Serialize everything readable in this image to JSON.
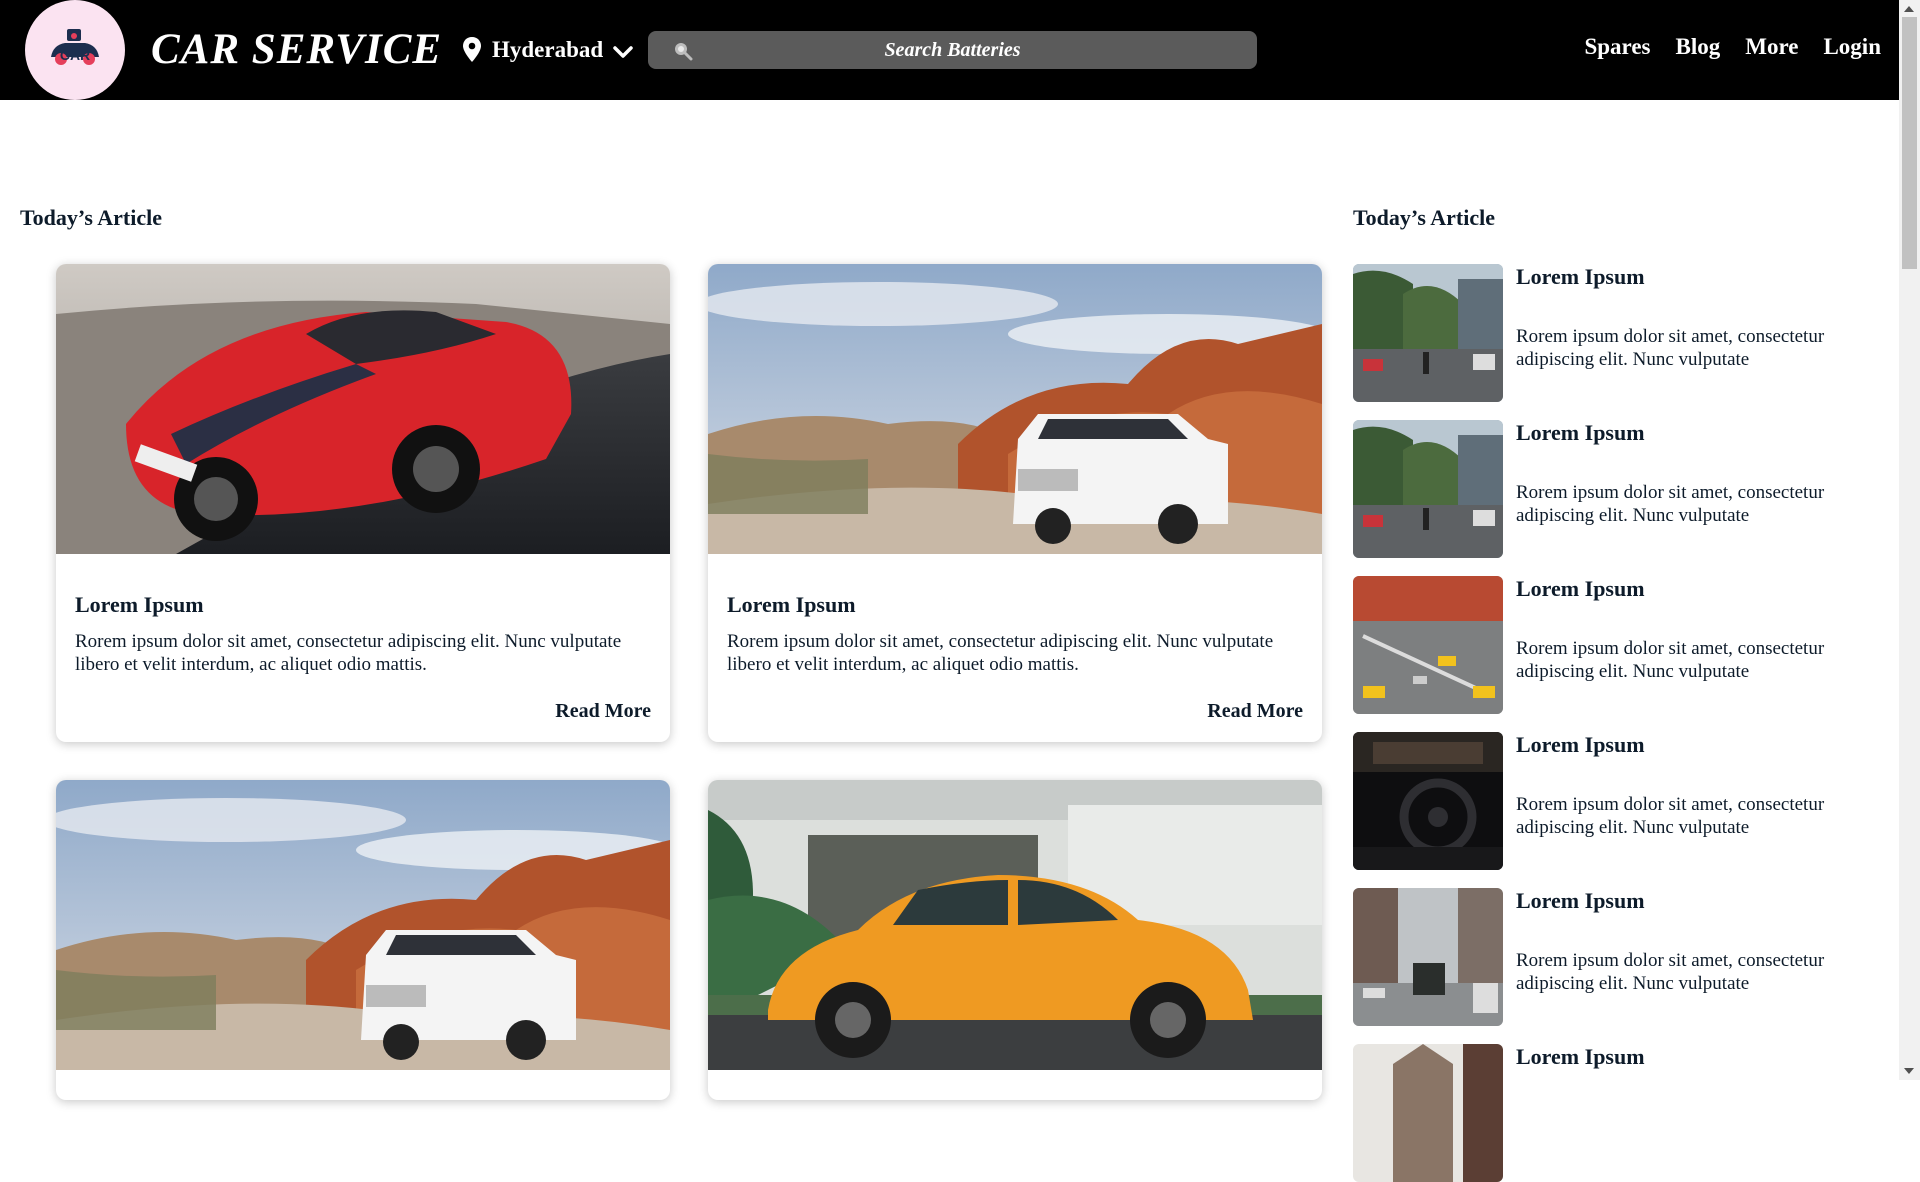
{
  "header": {
    "brand": "CAR SERVICE",
    "logo_icon": "car-logo-icon",
    "location": "Hyderabad",
    "search_placeholder": "Search Batteries",
    "nav": [
      "Spares",
      "Blog",
      "More",
      "Login"
    ]
  },
  "colors": {
    "header_bg": "#000000",
    "search_bg": "#5b5b5b",
    "logo_bg": "#fbe3f1",
    "text_dark": "#0d1b2a"
  },
  "main": {
    "section_title": "Today’s Article",
    "cards": [
      {
        "image": "red-sports-car-photo",
        "title": "Lorem Ipsum",
        "text": "Rorem ipsum dolor sit amet, consectetur adipiscing elit. Nunc vulputate libero et velit interdum, ac aliquet odio mattis.",
        "link": "Read More"
      },
      {
        "image": "white-suv-desert-photo",
        "title": "Lorem Ipsum",
        "text": "Rorem ipsum dolor sit amet, consectetur adipiscing elit. Nunc vulputate libero et velit interdum, ac aliquet odio mattis.",
        "link": "Read More"
      },
      {
        "image": "white-suv-desert-photo"
      },
      {
        "image": "orange-beetle-photo"
      }
    ]
  },
  "sidebar": {
    "section_title": "Today’s Article",
    "items": [
      {
        "image": "city-street-photo",
        "title": "Lorem Ipsum",
        "text": "Rorem ipsum dolor sit amet, consectetur adipiscing elit. Nunc vulputate"
      },
      {
        "image": "city-street-photo",
        "title": "Lorem Ipsum",
        "text": "Rorem ipsum dolor sit amet, consectetur adipiscing elit. Nunc vulputate"
      },
      {
        "image": "taxi-intersection-photo",
        "title": "Lorem Ipsum",
        "text": "Rorem ipsum dolor sit amet, consectetur adipiscing elit. Nunc vulputate"
      },
      {
        "image": "car-interior-photo",
        "title": "Lorem Ipsum",
        "text": "Rorem ipsum dolor sit amet, consectetur adipiscing elit. Nunc vulputate"
      },
      {
        "image": "downtown-traffic-photo",
        "title": "Lorem Ipsum",
        "text": "Rorem ipsum dolor sit amet, consectetur adipiscing elit. Nunc vulputate"
      },
      {
        "image": "building-photo",
        "title": "Lorem Ipsum"
      }
    ]
  }
}
